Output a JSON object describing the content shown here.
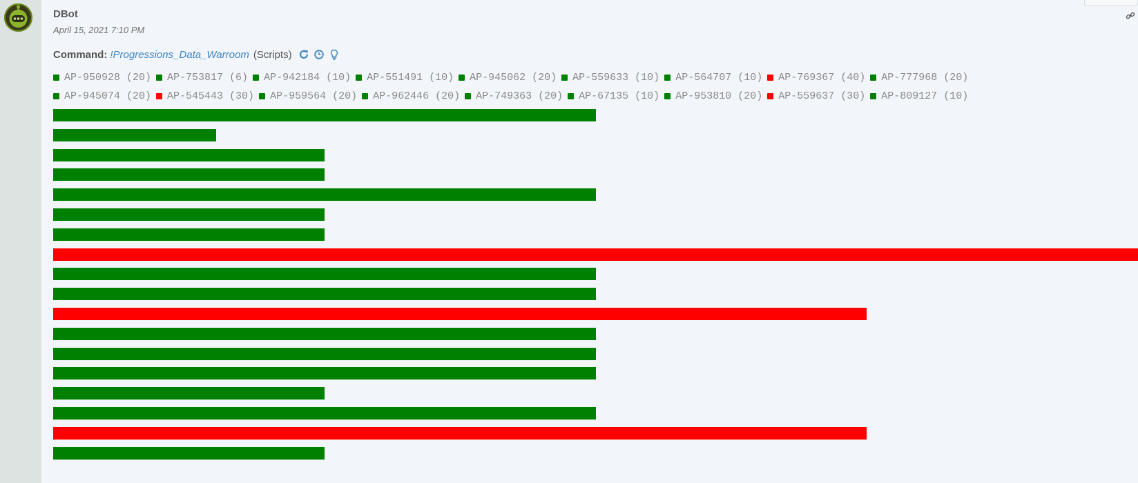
{
  "message": {
    "author": "DBot",
    "timestamp": "April 15, 2021 7:10 PM",
    "command_label": "Command:",
    "command_name": "!Progressions_Data_Warroom",
    "command_scope": "(Scripts)"
  },
  "icons": {
    "avatar": "robot-avatar",
    "link": "link-icon",
    "rerun": "refresh-icon",
    "history": "clock-icon",
    "tips": "lightbulb-icon"
  },
  "colors": {
    "green": "#008000",
    "red": "#ff0000",
    "link": "#3d85c6"
  },
  "chart_data": {
    "type": "bar",
    "orientation": "horizontal",
    "legend_placement": "top",
    "categories": [
      "AP-950928",
      "AP-753817",
      "AP-942184",
      "AP-551491",
      "AP-945062",
      "AP-559633",
      "AP-564707",
      "AP-769367",
      "AP-777968",
      "AP-945074",
      "AP-545443",
      "AP-959564",
      "AP-962446",
      "AP-749363",
      "AP-67135",
      "AP-953810",
      "AP-559637",
      "AP-809127"
    ],
    "values": [
      20,
      6,
      10,
      10,
      20,
      10,
      10,
      40,
      20,
      20,
      30,
      20,
      20,
      20,
      10,
      20,
      30,
      10
    ],
    "colors": [
      "green",
      "green",
      "green",
      "green",
      "green",
      "green",
      "green",
      "red",
      "green",
      "green",
      "red",
      "green",
      "green",
      "green",
      "green",
      "green",
      "red",
      "green"
    ],
    "value_labels": [
      "(20)",
      "(6)",
      "(10)",
      "(10)",
      "(20)",
      "(10)",
      "(10)",
      "(40)",
      "(20)",
      "(20)",
      "(30)",
      "(20)",
      "(20)",
      "(20)",
      "(10)",
      "(20)",
      "(30)",
      "(10)"
    ],
    "max_value": 40
  }
}
